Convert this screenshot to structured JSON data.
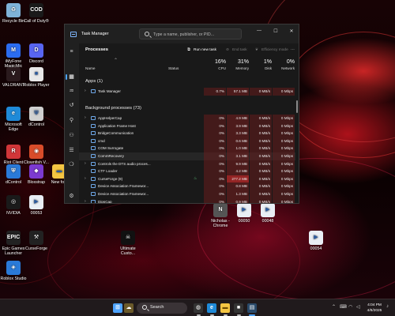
{
  "colors": {
    "accent": "#4da3ff",
    "window_bg": "#202020",
    "heat": "#3a1414"
  },
  "desktop_icons": [
    {
      "label": "Recycle Bin",
      "icon": "recycle-bin-icon",
      "color": "#7fb3d8",
      "glyph": "♻"
    },
    {
      "label": "Call of Duty®",
      "icon": "call-of-duty-icon",
      "color": "#1a1a1a",
      "glyph": "COD"
    },
    {
      "label": "iMyFone MagicMic",
      "icon": "magicmic-icon",
      "color": "#2b6cf0",
      "glyph": "M"
    },
    {
      "label": "Discord",
      "icon": "discord-icon",
      "color": "#5865f2",
      "glyph": "D"
    },
    {
      "label": "VALORANT",
      "icon": "valorant-icon",
      "color": "#2a1a1d",
      "glyph": "V"
    },
    {
      "label": "Roblox Player",
      "icon": "roblox-icon",
      "color": "#e8e8e8",
      "glyph": "■"
    },
    {
      "label": "Microsoft Edge",
      "icon": "edge-icon",
      "color": "#1f8ad8",
      "glyph": "e"
    },
    {
      "label": "dControl",
      "icon": "dcontrol-icon",
      "color": "#d0d0d0",
      "glyph": "⛨"
    },
    {
      "label": "Riot Client",
      "icon": "riot-client-icon",
      "color": "#d13639",
      "glyph": "R"
    },
    {
      "label": "Clownfish V...",
      "icon": "clownfish-icon",
      "color": "#d84c2a",
      "glyph": "◉"
    },
    {
      "label": "dControl",
      "icon": "dcontrol-icon",
      "color": "#2a7ad8",
      "glyph": "⛨"
    },
    {
      "label": "Bloxstrap",
      "icon": "bloxstrap-icon",
      "color": "#7c3ad0",
      "glyph": "◆"
    },
    {
      "label": "New fold",
      "icon": "folder-icon",
      "color": "#f4c542",
      "glyph": "▬"
    },
    {
      "label": "NVIDIA",
      "icon": "nvidia-icon",
      "color": "#1a1a1a",
      "glyph": "◎"
    },
    {
      "label": "00053",
      "icon": "file-icon",
      "color": "#e9eef5",
      "glyph": "▶"
    },
    {
      "label": "Nicholas - Chrome",
      "icon": "chrome-icon",
      "color": "#555555",
      "glyph": "N"
    },
    {
      "label": "00050",
      "icon": "file-icon",
      "color": "#e9eef5",
      "glyph": "▶"
    },
    {
      "label": "00048",
      "icon": "file-icon",
      "color": "#e9eef5",
      "glyph": "▶"
    },
    {
      "label": "Epic Games Launcher",
      "icon": "epic-games-icon",
      "color": "#222222",
      "glyph": "EPIC"
    },
    {
      "label": "CurseForge",
      "icon": "curseforge-icon",
      "color": "#222222",
      "glyph": "⚒"
    },
    {
      "label": "Ultimate Custo...",
      "icon": "ultimate-custom-icon",
      "color": "#111111",
      "glyph": "☠"
    },
    {
      "label": "00054",
      "icon": "file-icon",
      "color": "#e9eef5",
      "glyph": "▶"
    },
    {
      "label": "Roblox Studio",
      "icon": "roblox-studio-icon",
      "color": "#2a7ad8",
      "glyph": "◈"
    }
  ],
  "task_manager": {
    "app_name": "Task Manager",
    "search_placeholder": "Type a name, publisher, or PID...",
    "window_controls": {
      "minimize": "—",
      "maximize": "☐",
      "close": "✕"
    },
    "page_title": "Processes",
    "toolbar": {
      "run_new_task": "Run new task",
      "end_task": "End task",
      "efficiency_mode": "Efficiency mode",
      "more": "···"
    },
    "columns": {
      "name": "Name",
      "status": "Status",
      "cpu_pct": "16%",
      "cpu": "CPU",
      "memory_pct": "31%",
      "memory": "Memory",
      "disk_pct": "1%",
      "disk": "Disk",
      "network_pct": "0%",
      "network": "Network"
    },
    "apps_group": "Apps (1)",
    "apps": [
      {
        "name": "Task Manager",
        "cpu": "0.7%",
        "memory": "57.1 MB",
        "disk": "0 MB/s",
        "network": "0 Mbps",
        "expand": true
      }
    ],
    "bg_group": "Background processes (73)",
    "background": [
      {
        "name": "AppHelperCap",
        "cpu": "0%",
        "memory": "4.9 MB",
        "disk": "0 MB/s",
        "network": "0 Mbps",
        "expand": true,
        "status_icon": ""
      },
      {
        "name": "Application Frame Host",
        "cpu": "0%",
        "memory": "3.9 MB",
        "disk": "0 MB/s",
        "network": "0 Mbps",
        "expand": false,
        "status_icon": ""
      },
      {
        "name": "BridgeCommunication",
        "cpu": "0%",
        "memory": "3.3 MB",
        "disk": "0 MB/s",
        "network": "0 Mbps",
        "expand": false,
        "status_icon": ""
      },
      {
        "name": "cmd",
        "cpu": "0%",
        "memory": "0.6 MB",
        "disk": "0 MB/s",
        "network": "0 Mbps",
        "expand": false,
        "status_icon": ""
      },
      {
        "name": "COM Surrogate",
        "cpu": "0%",
        "memory": "1.0 MB",
        "disk": "0 MB/s",
        "network": "0 Mbps",
        "expand": false,
        "status_icon": ""
      },
      {
        "name": "CommRecovery",
        "cpu": "0%",
        "memory": "3.1 MB",
        "disk": "0 MB/s",
        "network": "0 Mbps",
        "expand": false,
        "status_icon": "",
        "selected": true
      },
      {
        "name": "Controls the DTS audio proces...",
        "cpu": "0%",
        "memory": "9.9 MB",
        "disk": "0 MB/s",
        "network": "0 Mbps",
        "expand": true,
        "status_icon": ""
      },
      {
        "name": "CTF Loader",
        "cpu": "0%",
        "memory": "4.2 MB",
        "disk": "0 MB/s",
        "network": "0 Mbps",
        "expand": false,
        "status_icon": ""
      },
      {
        "name": "CurseForge (9)",
        "cpu": "0%",
        "memory": "277.2 MB",
        "disk": "0 MB/s",
        "network": "0 Mbps",
        "expand": true,
        "status_icon": "♨"
      },
      {
        "name": "Device Association Framewor...",
        "cpu": "0%",
        "memory": "0.8 MB",
        "disk": "0 MB/s",
        "network": "0 Mbps",
        "expand": false,
        "status_icon": ""
      },
      {
        "name": "Device Association Framewor...",
        "cpu": "0%",
        "memory": "1.3 MB",
        "disk": "0 MB/s",
        "network": "0 Mbps",
        "expand": false,
        "status_icon": ""
      },
      {
        "name": "DipsCap",
        "cpu": "0%",
        "memory": "0.9 MB",
        "disk": "0 MB/s",
        "network": "0 Mbps",
        "expand": true,
        "status_icon": ""
      }
    ]
  },
  "taskbar": {
    "search_label": "Search",
    "items": [
      {
        "name": "start-button",
        "icon": "windows-logo-icon",
        "color": "#4da3ff",
        "glyph": "⊞"
      },
      {
        "name": "task-view-button",
        "icon": "widgets-icon",
        "color": "#6b5a2a",
        "glyph": "☁"
      },
      {
        "name": "taskbar-chrome",
        "icon": "chrome-icon",
        "color": "#333333",
        "glyph": "◍"
      },
      {
        "name": "taskbar-edge",
        "icon": "edge-icon",
        "color": "#1f8ad8",
        "glyph": "e"
      },
      {
        "name": "taskbar-file-explorer",
        "icon": "folder-icon",
        "color": "#f4c542",
        "glyph": "▬"
      },
      {
        "name": "taskbar-roblox",
        "icon": "roblox-icon",
        "color": "#333333",
        "glyph": "■"
      },
      {
        "name": "taskbar-task-manager",
        "icon": "task-manager-icon",
        "color": "#2a4a6a",
        "glyph": "▤"
      }
    ],
    "time": "4:04 PM",
    "date": "4/8/2025"
  }
}
